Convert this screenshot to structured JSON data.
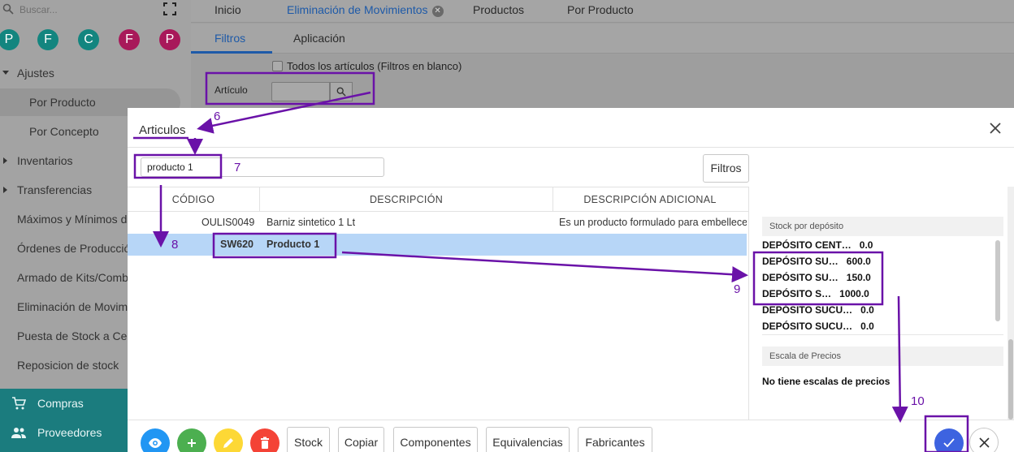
{
  "sidebar": {
    "search_placeholder": "Buscar...",
    "avatars": [
      {
        "letter": "P",
        "color": "#13857f"
      },
      {
        "letter": "F",
        "color": "#13857f"
      },
      {
        "letter": "C",
        "color": "#13857f"
      },
      {
        "letter": "F",
        "color": "#a8195a"
      },
      {
        "letter": "P",
        "color": "#a8195a"
      }
    ],
    "items": [
      {
        "label": "Ajustes"
      },
      {
        "label": "Por Producto"
      },
      {
        "label": "Por Concepto"
      },
      {
        "label": "Inventarios"
      },
      {
        "label": "Transferencias"
      },
      {
        "label": "Máximos y Mínimos d"
      },
      {
        "label": "Órdenes de Producció"
      },
      {
        "label": "Armado de Kits/Comb"
      },
      {
        "label": "Eliminación de Movim"
      },
      {
        "label": "Puesta de Stock a Cer"
      },
      {
        "label": "Reposicion de stock"
      }
    ],
    "bottom_items": [
      {
        "label": "Compras"
      },
      {
        "label": "Proveedores"
      }
    ]
  },
  "topbar": {
    "tabs": [
      {
        "label": "Inicio"
      },
      {
        "label": "Eliminación de Movimientos"
      },
      {
        "label": "Productos"
      },
      {
        "label": "Por Producto"
      }
    ],
    "close_glyph": "✕"
  },
  "subtabs": [
    {
      "label": "Filtros"
    },
    {
      "label": "Aplicación"
    }
  ],
  "filters": {
    "all_articles_label": "Todos los artículos (Filtros en blanco)",
    "article_label": "Artículo"
  },
  "modal": {
    "title": "Articulos",
    "search_value": "producto 1",
    "filtros_label": "Filtros",
    "columns": [
      "CÓDIGO",
      "DESCRIPCIÓN",
      "DESCRIPCIÓN ADICIONAL"
    ],
    "rows": [
      {
        "code": "OULIS0049",
        "description": "Barniz sintetico 1 Lt",
        "additional": "Es un producto formulado para embellecer"
      },
      {
        "code": "SW620",
        "description": "Producto 1",
        "additional": ""
      }
    ],
    "stock_title": "Stock por depósito",
    "stock": [
      {
        "deposit": "DEPÓSITO CENT…",
        "value": "0.0"
      },
      {
        "deposit": "DEPÓSITO SU…",
        "value": "600.0"
      },
      {
        "deposit": "DEPÓSITO SU…",
        "value": "150.0"
      },
      {
        "deposit": "DEPÓSITO S…",
        "value": "1000.0"
      },
      {
        "deposit": "DEPÓSITO SUCU…",
        "value": "0.0"
      },
      {
        "deposit": "DEPÓSITO SUCU…",
        "value": "0.0"
      }
    ],
    "price_scale_title": "Escala de Precios",
    "no_price_scales": "No tiene escalas de precios",
    "footer_buttons": [
      "Stock",
      "Copiar",
      "Componentes",
      "Equivalencias",
      "Fabricantes"
    ],
    "fab_colors": {
      "view": "#2196f3",
      "add": "#4caf50",
      "edit": "#fdd835",
      "delete": "#f44336"
    }
  },
  "annotations": {
    "color": "#6a12a8",
    "steps": [
      "6",
      "7",
      "8",
      "9",
      "10"
    ]
  }
}
